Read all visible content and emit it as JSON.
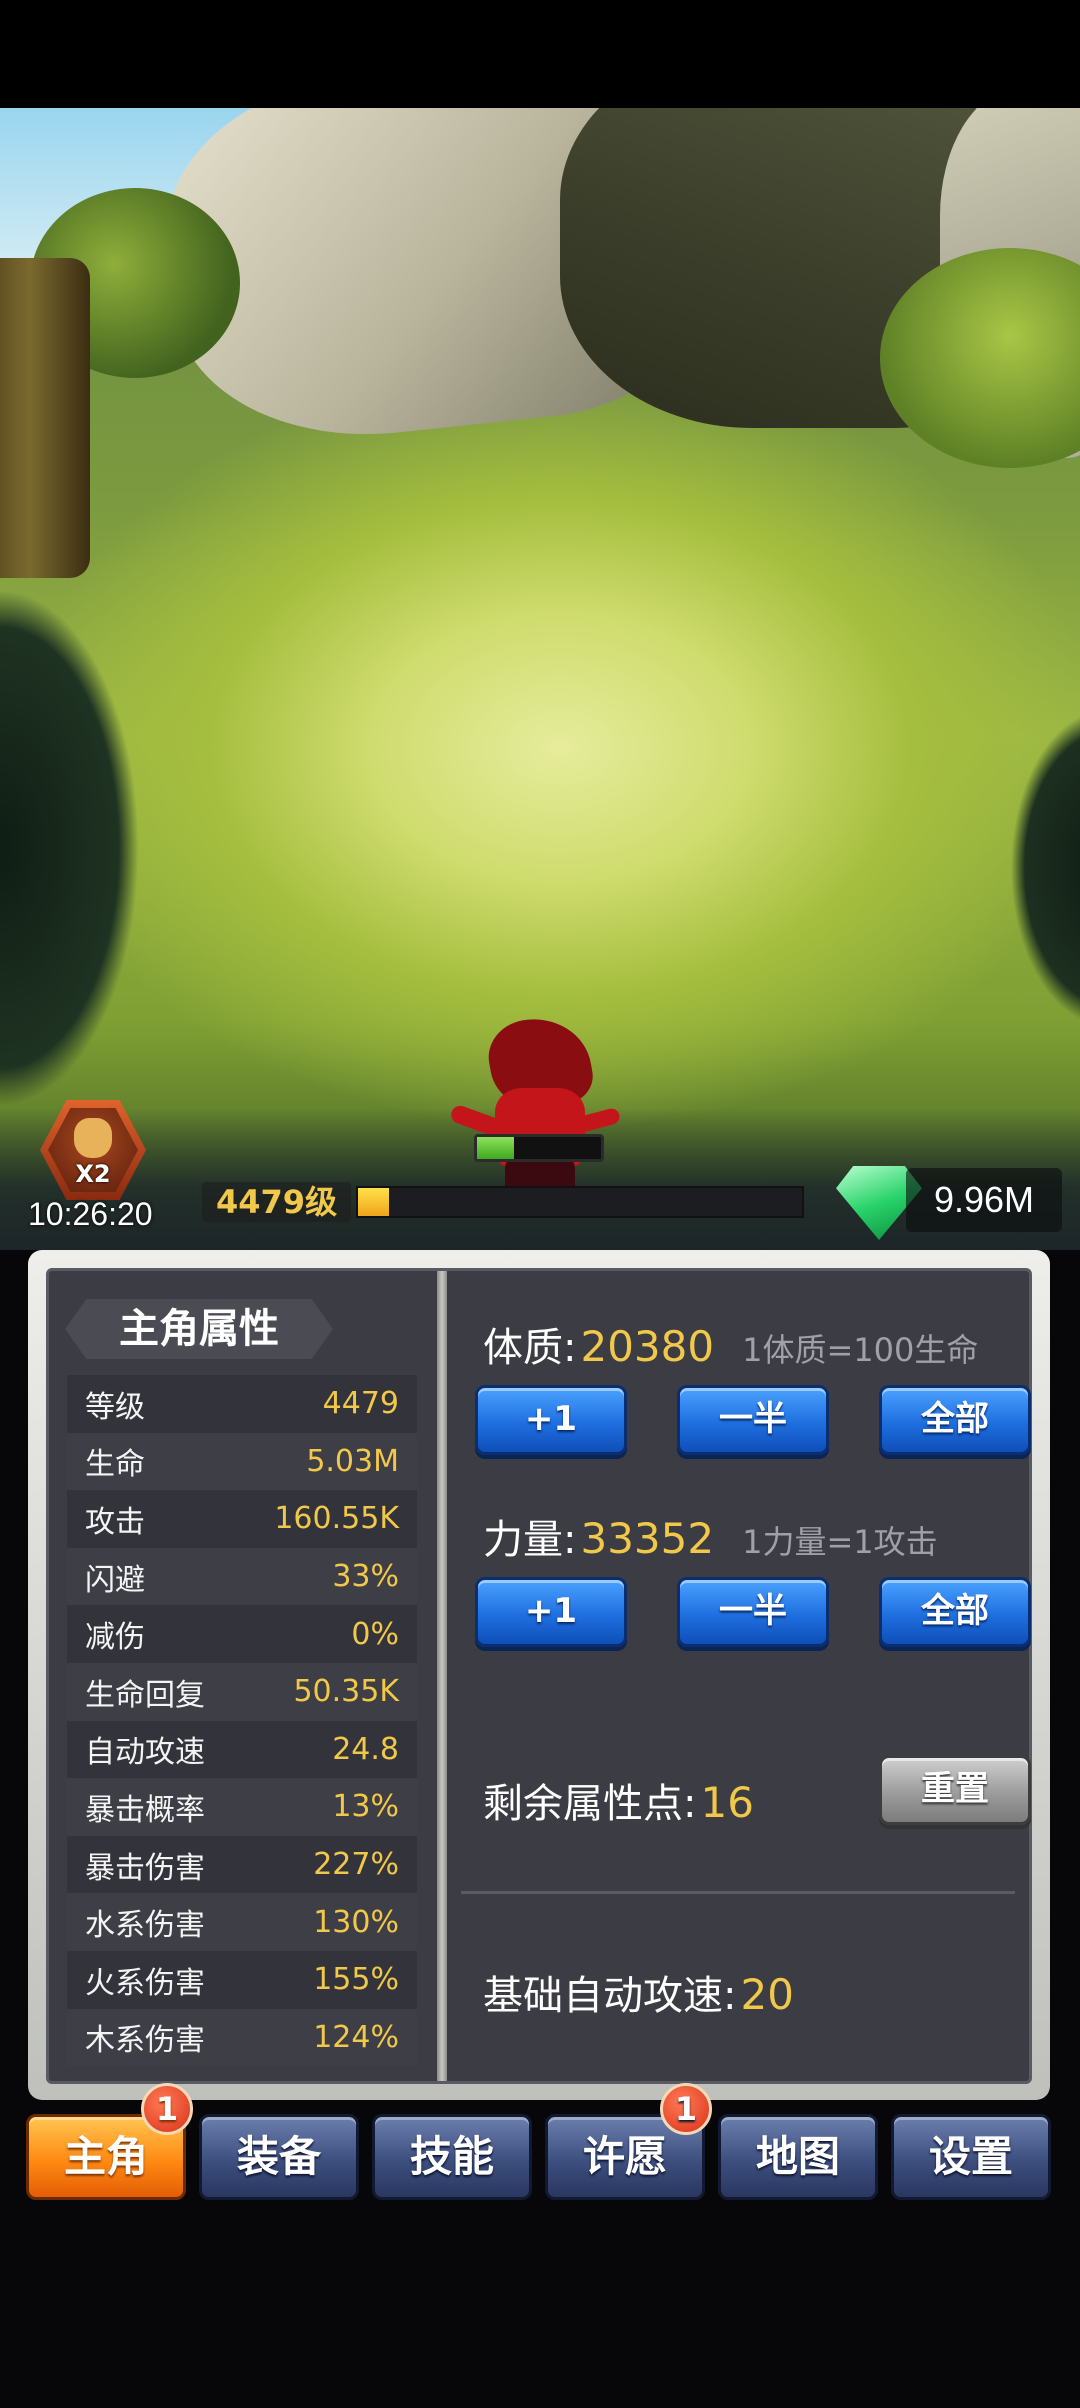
{
  "hud": {
    "boost_label": "X2",
    "timer": "10:26:20",
    "level_label": "4479级",
    "exp_progress": 0.07,
    "hp_progress": 0.3,
    "gems": "9.96M"
  },
  "panel": {
    "title": "主角属性",
    "stats": [
      {
        "label": "等级",
        "value": "4479"
      },
      {
        "label": "生命",
        "value": "5.03M"
      },
      {
        "label": "攻击",
        "value": "160.55K"
      },
      {
        "label": "闪避",
        "value": "33%"
      },
      {
        "label": "减伤",
        "value": "0%"
      },
      {
        "label": "生命回复",
        "value": "50.35K"
      },
      {
        "label": "自动攻速",
        "value": "24.8"
      },
      {
        "label": "暴击概率",
        "value": "13%"
      },
      {
        "label": "暴击伤害",
        "value": "227%"
      },
      {
        "label": "水系伤害",
        "value": "130%"
      },
      {
        "label": "火系伤害",
        "value": "155%"
      },
      {
        "label": "木系伤害",
        "value": "124%"
      }
    ],
    "constitution": {
      "name": "体质:",
      "value": "20380",
      "hint": "1体质=100生命"
    },
    "strength": {
      "name": "力量:",
      "value": "33352",
      "hint": "1力量=1攻击"
    },
    "buttons": {
      "plus_one": "+1",
      "half": "一半",
      "all": "全部",
      "reset": "重置"
    },
    "remaining_points": {
      "name": "剩余属性点:",
      "value": "16"
    },
    "base_attack_speed": {
      "name": "基础自动攻速:",
      "value": "20"
    }
  },
  "tabs": [
    {
      "label": "主角",
      "active": true,
      "badge": "1"
    },
    {
      "label": "装备",
      "active": false,
      "badge": ""
    },
    {
      "label": "技能",
      "active": false,
      "badge": ""
    },
    {
      "label": "许愿",
      "active": false,
      "badge": "1"
    },
    {
      "label": "地图",
      "active": false,
      "badge": ""
    },
    {
      "label": "设置",
      "active": false,
      "badge": ""
    }
  ],
  "colors": {
    "accent_gold": "#f1c84a",
    "tab_active": "#ff8a12",
    "button_blue": "#1f6fe0"
  }
}
